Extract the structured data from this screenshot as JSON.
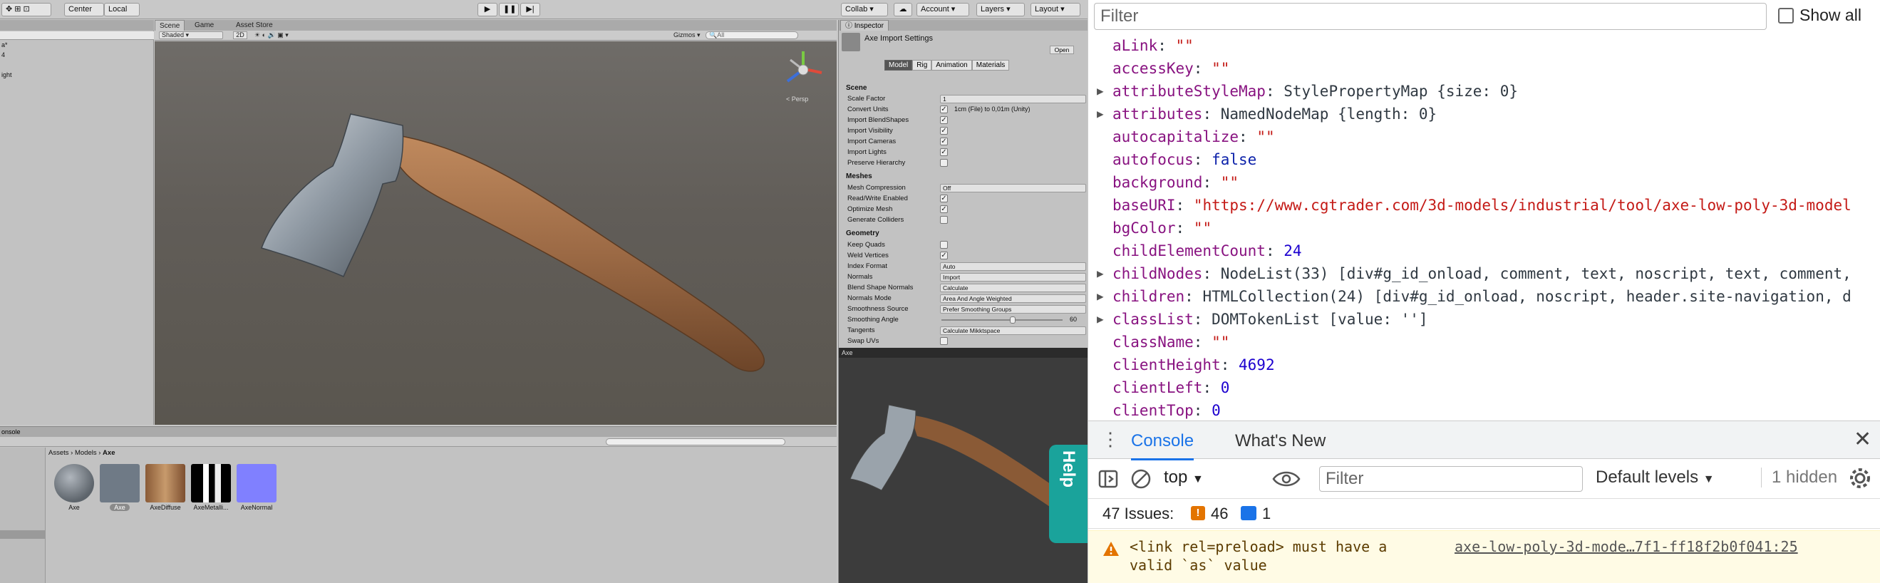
{
  "unity": {
    "toolbar": {
      "center": "Center",
      "local": "Local",
      "collab": "Collab",
      "account": "Account",
      "layers": "Layers",
      "layout": "Layout"
    },
    "hierarchy": {
      "items": [
        "a*",
        "4",
        "ight"
      ]
    },
    "scene": {
      "tabs": [
        "Scene",
        "Game",
        "Asset Store"
      ],
      "shading": "Shaded",
      "mode2d": "2D",
      "gizmos": "Gizmos",
      "search_placeholder": "All",
      "persp": "< Persp"
    },
    "inspector": {
      "tab": "Inspector",
      "title": "Axe Import Settings",
      "open_label": "Open",
      "tabs": [
        "Model",
        "Rig",
        "Animation",
        "Materials"
      ],
      "section_scene": "Scene",
      "scale_factor_label": "Scale Factor",
      "scale_factor_value": "1",
      "convert_units_label": "Convert Units",
      "convert_units_note": "1cm (File) to 0,01m (Unity)",
      "import_blendshapes": "Import BlendShapes",
      "import_visibility": "Import Visibility",
      "import_cameras": "Import Cameras",
      "import_lights": "Import Lights",
      "preserve_hierarchy": "Preserve Hierarchy",
      "section_meshes": "Meshes",
      "mesh_compression_label": "Mesh Compression",
      "mesh_compression_value": "Off",
      "read_write": "Read/Write Enabled",
      "optimize_mesh": "Optimize Mesh",
      "generate_colliders": "Generate Colliders",
      "section_geometry": "Geometry",
      "keep_quads": "Keep Quads",
      "weld_vertices": "Weld Vertices",
      "index_format_label": "Index Format",
      "index_format_value": "Auto",
      "normals_label": "Normals",
      "normals_value": "Import",
      "blend_shape_normals_label": "Blend Shape Normals",
      "blend_shape_normals_value": "Calculate",
      "normals_mode_label": "Normals Mode",
      "normals_mode_value": "Area And Angle Weighted",
      "smoothness_source_label": "Smoothness Source",
      "smoothness_source_value": "Prefer Smoothing Groups",
      "smoothing_angle_label": "Smoothing Angle",
      "smoothing_angle_value": "60",
      "tangents_label": "Tangents",
      "tangents_value": "Calculate Mikktspace",
      "swap_uvs": "Swap UVs"
    },
    "preview_title": "Axe",
    "console_label": "onsole",
    "project": {
      "breadcrumb": [
        "Assets",
        "Models",
        "Axe"
      ],
      "assets": [
        "Axe",
        "Axe",
        "AxeDiffuse",
        "AxeMetalli...",
        "AxeNormal"
      ]
    },
    "help": "Help"
  },
  "devtools": {
    "filter_placeholder": "Filter",
    "show_all": "Show all",
    "properties": [
      {
        "key": "aLink",
        "sep": ": ",
        "value": "\"\"",
        "vtype": "str",
        "expand": false
      },
      {
        "key": "accessKey",
        "sep": ": ",
        "value": "\"\"",
        "vtype": "str",
        "expand": false
      },
      {
        "key": "attributeStyleMap",
        "sep": ": ",
        "type": "StylePropertyMap",
        "value": "{size: 0}",
        "vtype": "obj",
        "expand": true
      },
      {
        "key": "attributes",
        "sep": ": ",
        "type": "NamedNodeMap",
        "value": "{length: 0}",
        "vtype": "obj",
        "expand": true
      },
      {
        "key": "autocapitalize",
        "sep": ": ",
        "value": "\"\"",
        "vtype": "str",
        "expand": false
      },
      {
        "key": "autofocus",
        "sep": ": ",
        "value": "false",
        "vtype": "kw",
        "expand": false
      },
      {
        "key": "background",
        "sep": ": ",
        "value": "\"\"",
        "vtype": "str",
        "expand": false
      },
      {
        "key": "baseURI",
        "sep": ": ",
        "value": "\"https://www.cgtrader.com/3d-models/industrial/tool/axe-low-poly-3d-model",
        "vtype": "str",
        "expand": false
      },
      {
        "key": "bgColor",
        "sep": ": ",
        "value": "\"\"",
        "vtype": "str",
        "expand": false
      },
      {
        "key": "childElementCount",
        "sep": ": ",
        "value": "24",
        "vtype": "num",
        "expand": false
      },
      {
        "key": "childNodes",
        "sep": ": ",
        "type": "NodeList(33)",
        "value": "[div#g_id_onload, comment, text, noscript, text, comment,",
        "vtype": "list",
        "expand": true
      },
      {
        "key": "children",
        "sep": ": ",
        "type": "HTMLCollection(24)",
        "value": "[div#g_id_onload, noscript, header.site-navigation, d",
        "vtype": "list",
        "expand": true
      },
      {
        "key": "classList",
        "sep": ": ",
        "type": "DOMTokenList",
        "value": "[value: '']",
        "vtype": "obj",
        "expand": true
      },
      {
        "key": "className",
        "sep": ": ",
        "value": "\"\"",
        "vtype": "str",
        "expand": false
      },
      {
        "key": "clientHeight",
        "sep": ": ",
        "value": "4692",
        "vtype": "num",
        "expand": false
      },
      {
        "key": "clientLeft",
        "sep": ": ",
        "value": "0",
        "vtype": "num",
        "expand": false
      },
      {
        "key": "clientTop",
        "sep": ": ",
        "value": "0",
        "vtype": "num",
        "expand": false
      }
    ],
    "console_tab": "Console",
    "whats_new_tab": "What's New",
    "context": "top",
    "console_filter_placeholder": "Filter",
    "levels": "Default levels",
    "hidden": "1 hidden",
    "issues_label": "47 Issues:",
    "warn_count": "46",
    "info_count": "1",
    "warning_text_1": "<link rel=preload> must have a",
    "warning_text_2": "valid `as` value",
    "warning_link": "axe-low-poly-3d-mode…7f1-ff18f2b0f041:25",
    "colors": {
      "accent": "#1a73e8",
      "warning_bg": "#fffbe5",
      "help_teal": "#1aa39b"
    }
  }
}
